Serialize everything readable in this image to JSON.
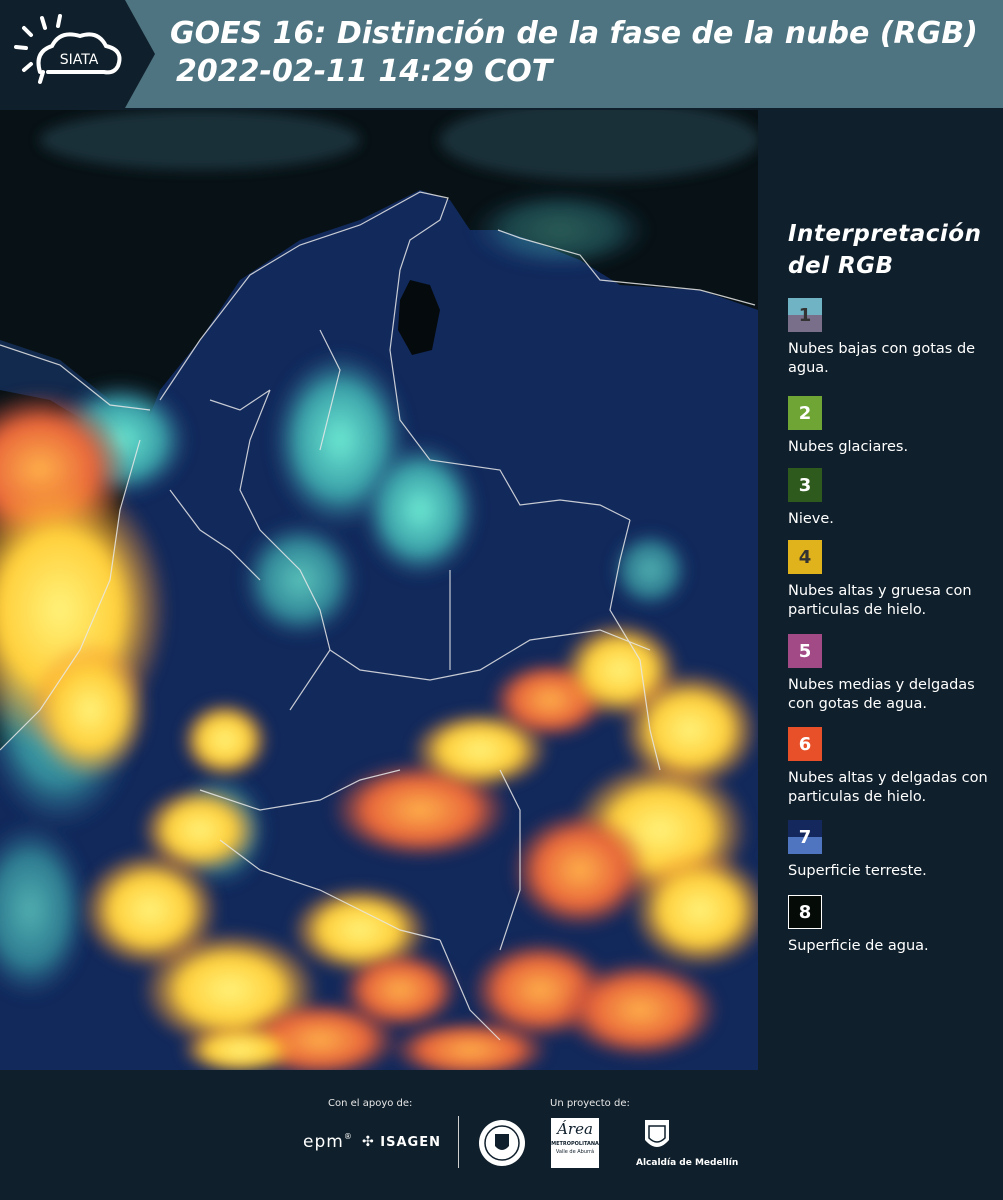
{
  "header": {
    "logo_text": "SIATA",
    "title_line1": "GOES 16: Distinción de la fase de la nube (RGB)",
    "title_line2": "2022-02-11 14:29 COT"
  },
  "legend": {
    "title_line1": "Interpretación",
    "title_line2": "del RGB",
    "items": [
      {
        "number": "1",
        "label": "Nubes bajas con gotas de agua.",
        "color_top": "#6fb3c4",
        "color_bottom": "#7a6f8a",
        "text_color": "#333333"
      },
      {
        "number": "2",
        "label": "Nubes glaciares.",
        "color_top": "#6ea535",
        "color_bottom": "#6ea535",
        "text_color": "#ffffff"
      },
      {
        "number": "3",
        "label": "Nieve.",
        "color_top": "#2f5a1e",
        "color_bottom": "#2f5a1e",
        "text_color": "#ffffff"
      },
      {
        "number": "4",
        "label": "Nubes altas y gruesa con particulas de hielo.",
        "color_top": "#e0b31c",
        "color_bottom": "#e0b31c",
        "text_color": "#333333"
      },
      {
        "number": "5",
        "label": "Nubes medias y delgadas con gotas de agua.",
        "color_top": "#a14a86",
        "color_bottom": "#a14a86",
        "text_color": "#ffffff"
      },
      {
        "number": "6",
        "label": "Nubes altas y delgadas con particulas de hielo.",
        "color_top": "#e8502a",
        "color_bottom": "#e8502a",
        "text_color": "#ffffff"
      },
      {
        "number": "7",
        "label": "Superficie terreste.",
        "color_top": "#14285e",
        "color_bottom": "#4f74c0",
        "text_color": "#ffffff"
      },
      {
        "number": "8",
        "label": "Superficie de agua.",
        "color_top": "#050b07",
        "color_bottom": "#050b07",
        "text_color": "#ffffff"
      }
    ]
  },
  "footer": {
    "support_label": "Con el apoyo de:",
    "project_label": "Un proyecto de:",
    "sponsor_epm": "epm",
    "sponsor_isagen": "ISAGEN",
    "partner_area_line1": "Área",
    "partner_area_line2": "METROPOLITANA",
    "partner_area_line3": "Valle de Aburrá",
    "partner_medellin": "Alcaldía de Medellín"
  },
  "colors": {
    "header_bg": "#4d7480",
    "panel_bg": "#0f1f2b",
    "ocean": "#0a1418",
    "land": "#12285a",
    "cloud_cyan": "#5fd6c8",
    "cloud_yellow": "#ffd84a",
    "cloud_orange": "#f08a3a"
  }
}
